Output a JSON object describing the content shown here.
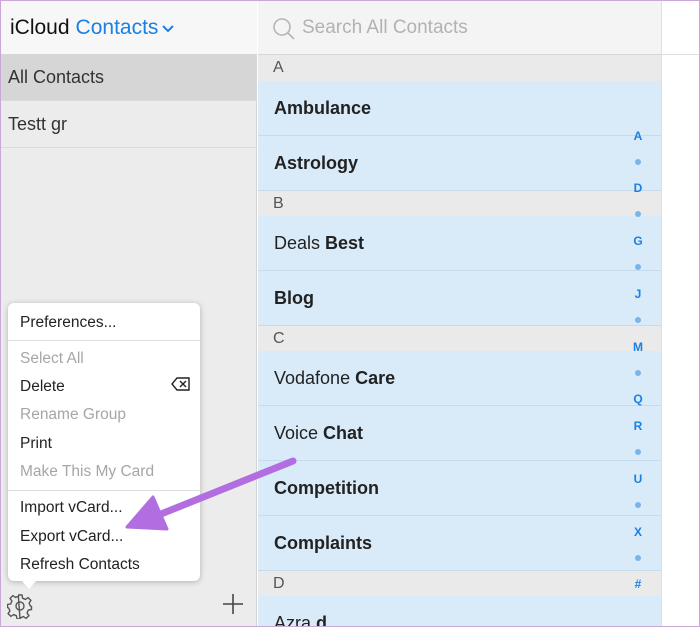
{
  "header": {
    "brand": "iCloud",
    "app": "Contacts",
    "chevron": "⌄"
  },
  "sidebar": {
    "groups": [
      {
        "label": "All Contacts",
        "selected": true
      },
      {
        "label": "Testt gr",
        "selected": false
      }
    ]
  },
  "menu": {
    "items": [
      {
        "label": "Preferences...",
        "enabled": true
      },
      {
        "label": "Select All",
        "enabled": false
      },
      {
        "label": "Delete",
        "enabled": true,
        "shortcut_icon": "delete-key-icon"
      },
      {
        "label": "Rename Group",
        "enabled": false
      },
      {
        "label": "Print",
        "enabled": true
      },
      {
        "label": "Make This My Card",
        "enabled": false
      },
      {
        "label": "Import vCard...",
        "enabled": true
      },
      {
        "label": "Export vCard...",
        "enabled": true
      },
      {
        "label": "Refresh Contacts",
        "enabled": true
      }
    ]
  },
  "search": {
    "placeholder": "Search All Contacts",
    "value": ""
  },
  "contacts": {
    "sections": [
      {
        "letter": "A",
        "items": [
          {
            "first": "",
            "last": "Ambulance"
          },
          {
            "first": "",
            "last": "Astrology"
          }
        ]
      },
      {
        "letter": "B",
        "items": [
          {
            "first": "Deals",
            "last": "Best"
          },
          {
            "first": "",
            "last": "Blog"
          }
        ]
      },
      {
        "letter": "C",
        "items": [
          {
            "first": "Vodafone",
            "last": "Care"
          },
          {
            "first": "Voice",
            "last": "Chat"
          },
          {
            "first": "",
            "last": "Competition"
          },
          {
            "first": "",
            "last": "Complaints"
          }
        ]
      },
      {
        "letter": "D",
        "items": [
          {
            "first": "Azra",
            "last": "d"
          }
        ]
      }
    ]
  },
  "index": [
    "A",
    "D",
    "G",
    "J",
    "M",
    "Q",
    "R",
    "U",
    "X",
    "#"
  ],
  "colors": {
    "accent": "#1a80e6",
    "row_bg": "#d9ebf9",
    "arrow": "#b26ee0"
  }
}
